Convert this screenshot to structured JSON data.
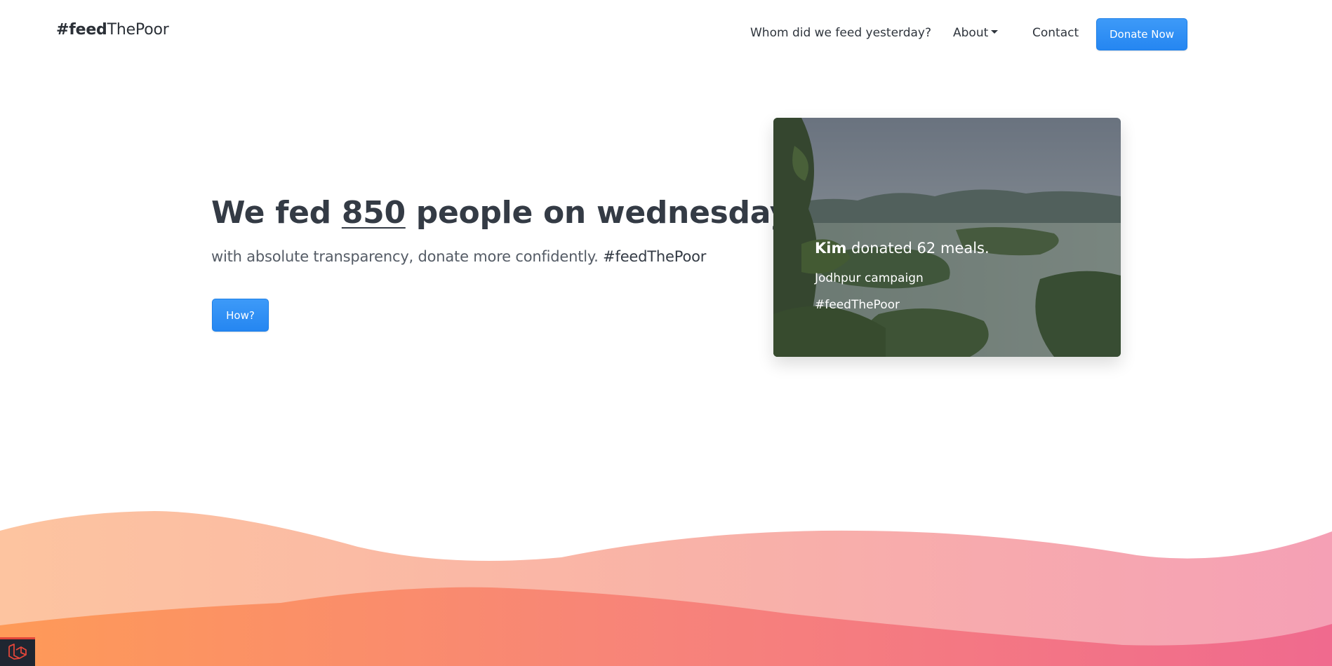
{
  "navbar": {
    "brand_bold": "#feed",
    "brand_rest": "ThePoor",
    "links": {
      "whom": "Whom did we feed yesterday?",
      "about": "About",
      "contact": "Contact"
    },
    "donate_label": "Donate Now"
  },
  "hero": {
    "title_prefix": "We fed ",
    "count": "850",
    "title_suffix": " people on wednesday.",
    "subtitle": "with absolute transparency, donate more confidently. ",
    "subtitle_tag": "#feedThePoor",
    "how_label": "How?"
  },
  "card": {
    "donor": "Kim",
    "donation_text": " donated 62 meals.",
    "campaign": "Jodhpur campaign",
    "hashtag": "#feedThePoor"
  },
  "colors": {
    "primary": "#2586f1",
    "wave_light_start": "#fdc4a0",
    "wave_light_end": "#f5a0b5",
    "wave_dark_start": "#fe9a58",
    "wave_dark_end": "#f06a8e"
  },
  "icons": {
    "debug_badge": "laravel-icon",
    "about_caret": "caret-down-icon"
  }
}
